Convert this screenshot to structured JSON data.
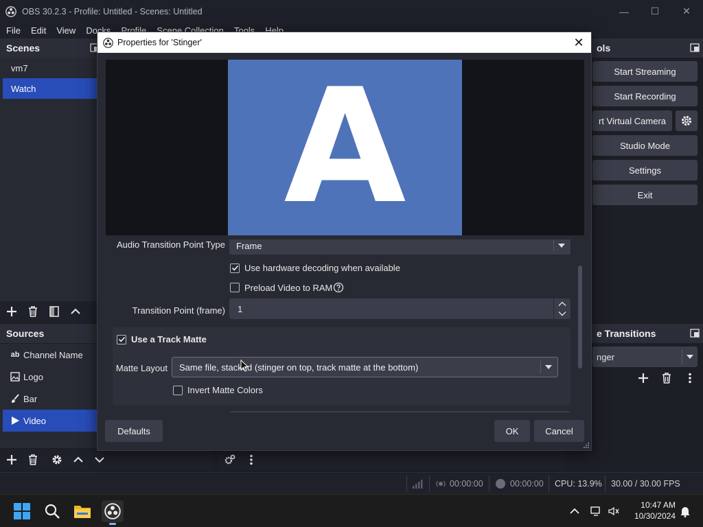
{
  "window": {
    "title": "OBS 30.2.3 - Profile: Untitled - Scenes: Untitled",
    "minimize": "—",
    "maximize": "☐",
    "close": "✕"
  },
  "menu": [
    "File",
    "Edit",
    "View",
    "Docks",
    "Profile",
    "Scene Collection",
    "Tools",
    "Help"
  ],
  "scenes": {
    "title": "Scenes",
    "items": [
      {
        "label": "vm7",
        "selected": false
      },
      {
        "label": "Watch",
        "selected": true
      }
    ]
  },
  "sources": {
    "title": "Sources",
    "items": [
      {
        "label": "Channel Name",
        "icon": "text-icon",
        "glyph": "ab"
      },
      {
        "label": "Logo",
        "icon": "image-icon"
      },
      {
        "label": "Bar",
        "icon": "brush-icon"
      },
      {
        "label": "Video",
        "icon": "play-icon",
        "selected": true
      }
    ]
  },
  "controls": {
    "title": "ols",
    "start_streaming": "Start Streaming",
    "start_recording": "Start Recording",
    "virtual_camera": "rt Virtual Camera",
    "studio_mode": "Studio Mode",
    "settings": "Settings",
    "exit": "Exit"
  },
  "transitions": {
    "title": "e Transitions",
    "selected": "nger"
  },
  "status": {
    "stream_time": "00:00:00",
    "record_time": "00:00:00",
    "cpu": "CPU: 13.9%",
    "fps": "30.00 / 30.00 FPS"
  },
  "dialog": {
    "title": "Properties for 'Stinger'",
    "close": "✕",
    "preview_letter": "A",
    "audio_transition_label": "Audio Transition Point Type",
    "audio_transition_value": "Frame",
    "hw_decoding_label": "Use hardware decoding when available",
    "hw_decoding_checked": true,
    "preload_label": "Preload Video to RAM",
    "preload_checked": false,
    "transition_point_label": "Transition Point (frame)",
    "transition_point_value": "1",
    "track_matte_label": "Use a Track Matte",
    "track_matte_checked": true,
    "matte_layout_label": "Matte Layout",
    "matte_layout_value": "Same file, stacked (stinger on top, track matte at the bottom)",
    "invert_label": "Invert Matte Colors",
    "invert_checked": false,
    "defaults_button": "Defaults",
    "ok_button": "OK",
    "cancel_button": "Cancel"
  },
  "taskbar": {
    "time": "10:47 AM",
    "date": "10/30/2024"
  },
  "colors": {
    "accent": "#284cb8",
    "preview_bg": "#4f73b8",
    "panel": "#272a33",
    "button": "#3b3e4a"
  }
}
